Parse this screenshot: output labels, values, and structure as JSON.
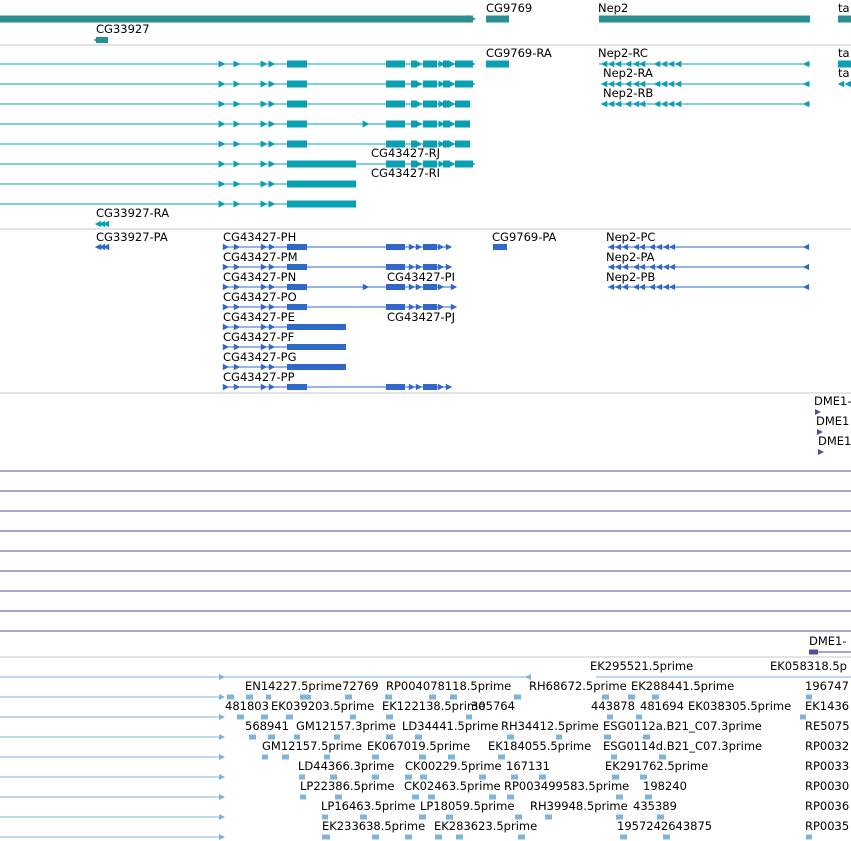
{
  "colors": {
    "gene": "#2a8f8f",
    "transcript": "#0aa0b4",
    "cds": "#2f68c8",
    "blast": "#5a4a9a",
    "est": "#7db4d8",
    "divider": "#c8c8c8"
  },
  "tracks": {
    "genes": {
      "labels": [
        "CG9769",
        "Nep2",
        "ta",
        "CG33927"
      ]
    },
    "transcripts": {
      "labels": [
        "CG9769-RA",
        "Nep2-RC",
        "ta",
        "Nep2-RA",
        "ta",
        "Nep2-RB",
        "CG43427-RJ",
        "CG43427-RI",
        "CG33927-RA"
      ]
    },
    "cds": {
      "labels": [
        "CG33927-PA",
        "CG43427-PH",
        "CG9769-PA",
        "Nep2-PC",
        "CG43427-PM",
        "Nep2-PA",
        "CG43427-PN",
        "CG43427-PI",
        "Nep2-PB",
        "CG43427-PO",
        "CG43427-PE",
        "CG43427-PJ",
        "CG43427-PF",
        "CG43427-PG",
        "CG43427-PP"
      ]
    },
    "blast": {
      "labels": [
        "DME1-",
        "DME1",
        "DME1",
        "DME1-"
      ]
    },
    "est": {
      "labels": [
        "EK295521.5prime",
        "EK058318.5p",
        "EN14227.5prime",
        "72769",
        "RP004078118.5prime",
        "RH68672.5prime",
        "EK288441.5prime",
        "196747",
        "481803",
        "EK039203.5prime",
        "EK122138.5prime",
        "305764",
        "443878",
        "481694",
        "EK038305.5prime",
        "EK1436",
        "568941",
        "GM12157.3prime",
        "LD34441.5prime",
        "RH34412.5prime",
        "ESG0112a.B21_C07.3prime",
        "RE5075",
        "GM12157.5prime",
        "EK067019.5prime",
        "EK184055.5prime",
        "ESG0114d.B21_C07.3prime",
        "RP0032",
        "LD44366.3prime",
        "CK00229.5prime",
        "167131",
        "EK291762.5prime",
        "RP0033",
        "LP22386.5prime",
        "CK02463.5prime",
        "RP003499583.5prime",
        "198240",
        "RP0030",
        "LP16463.5prime",
        "LP18059.5prime",
        "RH39948.5prime",
        "435389",
        "RP0036",
        "EK233638.5prime",
        "EK283623.5prime",
        "1957242643875",
        "RP0035"
      ]
    }
  }
}
